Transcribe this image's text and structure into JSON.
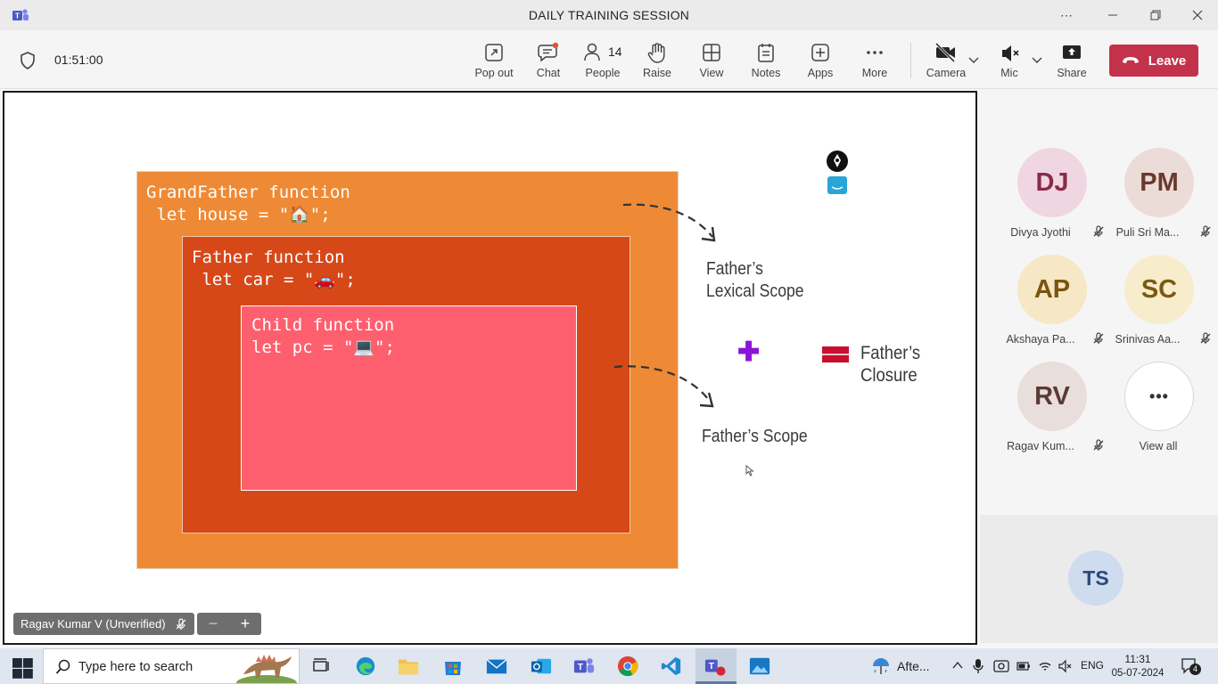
{
  "window": {
    "title": "DAILY TRAINING SESSION",
    "more_label": "⋯"
  },
  "toolbar": {
    "timer": "01:51:00",
    "buttons": [
      {
        "id": "popout",
        "label": "Pop out",
        "icon": "pop-out-icon"
      },
      {
        "id": "chat",
        "label": "Chat",
        "icon": "chat-icon"
      },
      {
        "id": "people",
        "label": "People",
        "icon": "people-icon",
        "count": "14"
      },
      {
        "id": "raise",
        "label": "Raise",
        "icon": "raise-hand-icon"
      },
      {
        "id": "view",
        "label": "View",
        "icon": "view-grid-icon"
      },
      {
        "id": "notes",
        "label": "Notes",
        "icon": "notes-icon"
      },
      {
        "id": "apps",
        "label": "Apps",
        "icon": "apps-plus-icon"
      },
      {
        "id": "more",
        "label": "More",
        "icon": "more-dots-icon"
      },
      {
        "id": "camera",
        "label": "Camera",
        "icon": "camera-off-icon"
      },
      {
        "id": "mic",
        "label": "Mic",
        "icon": "mic-off-icon"
      },
      {
        "id": "share",
        "label": "Share",
        "icon": "share-icon"
      }
    ],
    "leave_label": "Leave",
    "leave_color": "#c4314b"
  },
  "slide": {
    "grandfather": {
      "line1": "GrandFather function",
      "line2": " let house = \"🏠\";"
    },
    "father": {
      "line1": "Father function",
      "line2": " let car = \"🚗\";"
    },
    "child": {
      "line1": "Child function",
      "line2": "let pc = \"💻\";"
    },
    "annotations": {
      "lexical_scope": [
        "Father’s",
        "Lexical Scope"
      ],
      "scope": "Father’s Scope",
      "closure": "Father’s Closure",
      "plus": "✚"
    },
    "colors": {
      "grandfather": "#ee8a35",
      "father": "#d74818",
      "child": "#fe5f6e"
    }
  },
  "presenter": {
    "name": "Ragav Kumar V (Unverified)",
    "zoom_out": "−",
    "zoom_in": "+"
  },
  "participants": [
    {
      "initials": "DJ",
      "name": "Divya Jyothi",
      "bg": "#f0d6e0",
      "fg": "#8a2a4a",
      "muted": true
    },
    {
      "initials": "PM",
      "name": "Puli Sri Ma...",
      "bg": "#ecdcd8",
      "fg": "#6a3a2e",
      "muted": true
    },
    {
      "initials": "AP",
      "name": "Akshaya Pa...",
      "bg": "#f6e8c4",
      "fg": "#7a5410",
      "muted": true
    },
    {
      "initials": "SC",
      "name": "Srinivas Aa...",
      "bg": "#f7edcc",
      "fg": "#7a5a10",
      "muted": true
    },
    {
      "initials": "RV",
      "name": "Ragav Kum...",
      "bg": "#e8dedc",
      "fg": "#5a3a34",
      "muted": true
    },
    {
      "initials": "•••",
      "name": "View all",
      "bg": "#ffffff",
      "fg": "#333333",
      "muted": false
    }
  ],
  "self_view": {
    "initials": "TS"
  },
  "taskbar": {
    "search_placeholder": "Type here to search",
    "weather": "Afte...",
    "language": "ENG",
    "time": "11:31",
    "date": "05-07-2024",
    "notifications": "4"
  }
}
